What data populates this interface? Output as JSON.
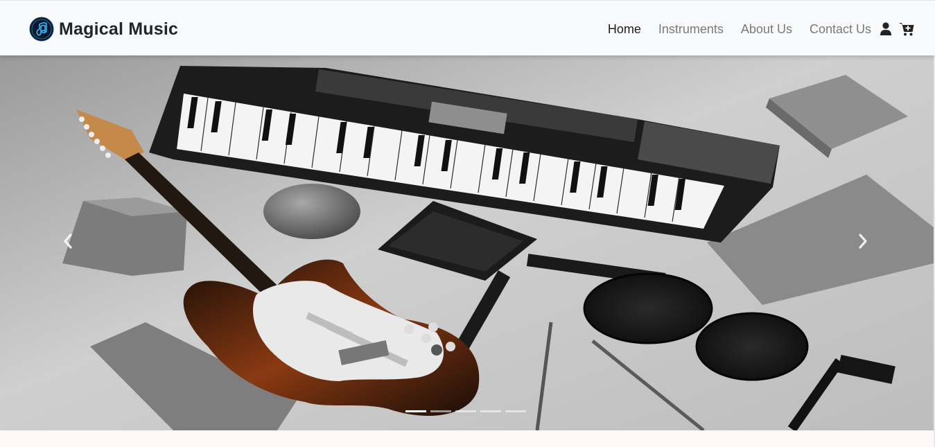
{
  "brand": {
    "name": "Magical Music",
    "logo_icon": "music-note-logo-icon"
  },
  "nav": {
    "links": [
      {
        "label": "Home",
        "active": true
      },
      {
        "label": "Instruments",
        "active": false
      },
      {
        "label": "About Us",
        "active": false
      },
      {
        "label": "Contact Us",
        "active": false
      }
    ],
    "icons": [
      "user-icon",
      "cart-plus-icon"
    ]
  },
  "carousel": {
    "slide_count": 5,
    "active_index": 0,
    "prev_icon": "chevron-left-icon",
    "next_icon": "chevron-right-icon",
    "slide_image": "musical-instruments-keyboard-guitar-drum-pads"
  },
  "colors": {
    "navbar_bg": "#f8f9fa",
    "active_link": "#1f1f1f",
    "inactive_link": "#7a7a7a"
  }
}
